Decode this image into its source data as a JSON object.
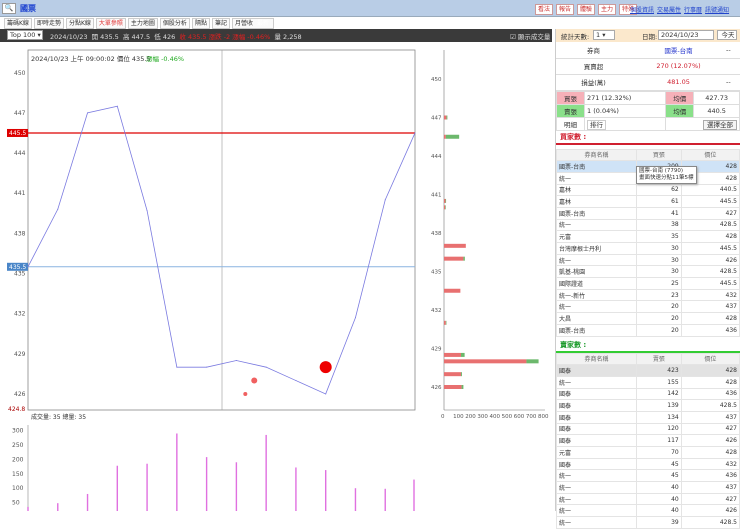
{
  "title": "國票",
  "top_buttons": [
    "看法",
    "報告",
    "體驗",
    "主力",
    "特殊"
  ],
  "top_links": [
    "個股資訊",
    "交易屬性",
    "行事曆",
    "訊號通知"
  ],
  "tabs": [
    {
      "label": "籌碼K線"
    },
    {
      "label": "即時走勢"
    },
    {
      "label": "分點K線"
    },
    {
      "label": "大單參照",
      "active": true
    },
    {
      "label": "主力地圖"
    },
    {
      "label": "個股分析"
    },
    {
      "label": "隔點"
    },
    {
      "label": "筆記"
    },
    {
      "label": "月營收",
      "badge": "最新"
    }
  ],
  "toolbar": {
    "top_select": "Top 100",
    "date": "2024/10/23",
    "open": "開 435.5",
    "high": "高 447.5",
    "low": "低 426",
    "close_red": "收 435.5  漲跌 -2  漲幅 -0.46%",
    "volume": "量 2,258",
    "show_volume": "顯示成交量"
  },
  "main_chart": {
    "header": "2024/10/23 上午 09:00:02  價位 435.5",
    "change": "漲幅 -0.46%",
    "ref_high_label": "445.5",
    "ref_cur_label": "435.5",
    "min_label": "424.8",
    "volume_header": "成交量: 35   總量: 35"
  },
  "chart_data": [
    {
      "type": "line",
      "name": "price",
      "ylim": [
        424.8,
        451.7
      ],
      "yticks": [
        450,
        447,
        444,
        441,
        438,
        435,
        432,
        429,
        426
      ],
      "values": [
        435.5,
        439.8,
        447,
        447.5,
        439.7,
        428,
        428,
        428.5,
        428,
        427,
        426,
        431.7,
        440.5,
        445.5
      ],
      "ref_lines": [
        445.5,
        435.5
      ],
      "bubbles": [
        {
          "index": 10.0,
          "price": 428,
          "size": 3
        },
        {
          "index": 7.6,
          "price": 427,
          "size": 1.5
        },
        {
          "index": 7.3,
          "price": 426,
          "size": 1
        }
      ]
    },
    {
      "type": "bar",
      "name": "volume",
      "ylim": [
        0,
        330
      ],
      "yticks": [
        300,
        250,
        200,
        150,
        100,
        50
      ],
      "values": [
        35,
        48,
        80,
        178,
        185,
        290,
        208,
        190,
        285,
        172,
        163,
        100,
        98,
        130
      ]
    },
    {
      "type": "bar",
      "orientation": "horizontal",
      "name": "price-volume",
      "xlim": [
        0,
        800
      ],
      "xticks": [
        0,
        100,
        200,
        300,
        400,
        500,
        600,
        700,
        800
      ],
      "yticks": [
        450,
        447,
        444,
        441,
        438,
        435,
        432,
        429,
        426
      ],
      "bars": [
        {
          "price": 447,
          "buy": 20,
          "sell": 8
        },
        {
          "price": 445.5,
          "buy": 15,
          "sell": 110
        },
        {
          "price": 440.5,
          "buy": 12,
          "sell": 5
        },
        {
          "price": 440,
          "buy": 10,
          "sell": 5
        },
        {
          "price": 437,
          "buy": 180,
          "sell": 0
        },
        {
          "price": 436,
          "buy": 160,
          "sell": 12
        },
        {
          "price": 433.5,
          "buy": 135,
          "sell": 0
        },
        {
          "price": 431,
          "buy": 15,
          "sell": 5
        },
        {
          "price": 428.5,
          "buy": 140,
          "sell": 30
        },
        {
          "price": 428,
          "buy": 680,
          "sell": 100
        },
        {
          "price": 427,
          "buy": 140,
          "sell": 8
        },
        {
          "price": 426,
          "buy": 145,
          "sell": 15
        }
      ]
    }
  ],
  "right": {
    "days_label": "統計天數:",
    "days": "1",
    "date_label": "日期:",
    "date": "2024/10/23",
    "today": "今天",
    "broker_label": "券商",
    "broker": "國票-台南",
    "net_label": "買賣超",
    "net": "270 (12.07%)",
    "pnl_label": "損益(萬)",
    "pnl": "481.05",
    "dash": "--",
    "buy_label": "買張",
    "buy": "271 (12.32%)",
    "buy_avg_label": "均價",
    "buy_avg": "427.73",
    "sell_label": "賣張",
    "sell": "1 (0.04%)",
    "sell_avg_label": "均價",
    "sell_avg": "440.5",
    "detail": "明細",
    "rank": "排行",
    "select_all": "選擇全部",
    "buyers_title": "買家數 :",
    "sellers_title": "賣家數 :",
    "buy_cols": [
      "券商名稱",
      "買張",
      "價位"
    ],
    "sell_cols": [
      "券商名稱",
      "賣張",
      "價位"
    ],
    "tooltip": [
      "國票-台南 (7790)",
      "畫面快速分點11筆5標"
    ],
    "buyers": [
      [
        "國票-台南",
        "209",
        "428"
      ],
      [
        "統一",
        "84",
        "428"
      ],
      [
        "嘉林",
        "62",
        "440.5"
      ],
      [
        "嘉林",
        "61",
        "445.5"
      ],
      [
        "國票-台南",
        "41",
        "427"
      ],
      [
        "統一",
        "38",
        "428.5"
      ],
      [
        "元富",
        "35",
        "428"
      ],
      [
        "台灣摩根士丹利",
        "30",
        "445.5"
      ],
      [
        "統一",
        "30",
        "426"
      ],
      [
        "凱基-桃園",
        "30",
        "428.5"
      ],
      [
        "國際證道",
        "25",
        "445.5"
      ],
      [
        "統一-新竹",
        "23",
        "432"
      ],
      [
        "統一",
        "20",
        "437"
      ],
      [
        "大昌",
        "20",
        "428"
      ],
      [
        "國票-台南",
        "20",
        "436"
      ]
    ],
    "sellers": [
      [
        "國泰",
        "423",
        "428"
      ],
      [
        "統一",
        "155",
        "428"
      ],
      [
        "國泰",
        "142",
        "436"
      ],
      [
        "國泰",
        "139",
        "428.5"
      ],
      [
        "國泰",
        "134",
        "437"
      ],
      [
        "國泰",
        "120",
        "427"
      ],
      [
        "國泰",
        "117",
        "426"
      ],
      [
        "元富",
        "70",
        "428"
      ],
      [
        "國泰",
        "45",
        "432"
      ],
      [
        "統一",
        "45",
        "436"
      ],
      [
        "統一",
        "40",
        "437"
      ],
      [
        "統一",
        "40",
        "427"
      ],
      [
        "統一",
        "40",
        "426"
      ],
      [
        "統一",
        "39",
        "428.5"
      ]
    ]
  }
}
